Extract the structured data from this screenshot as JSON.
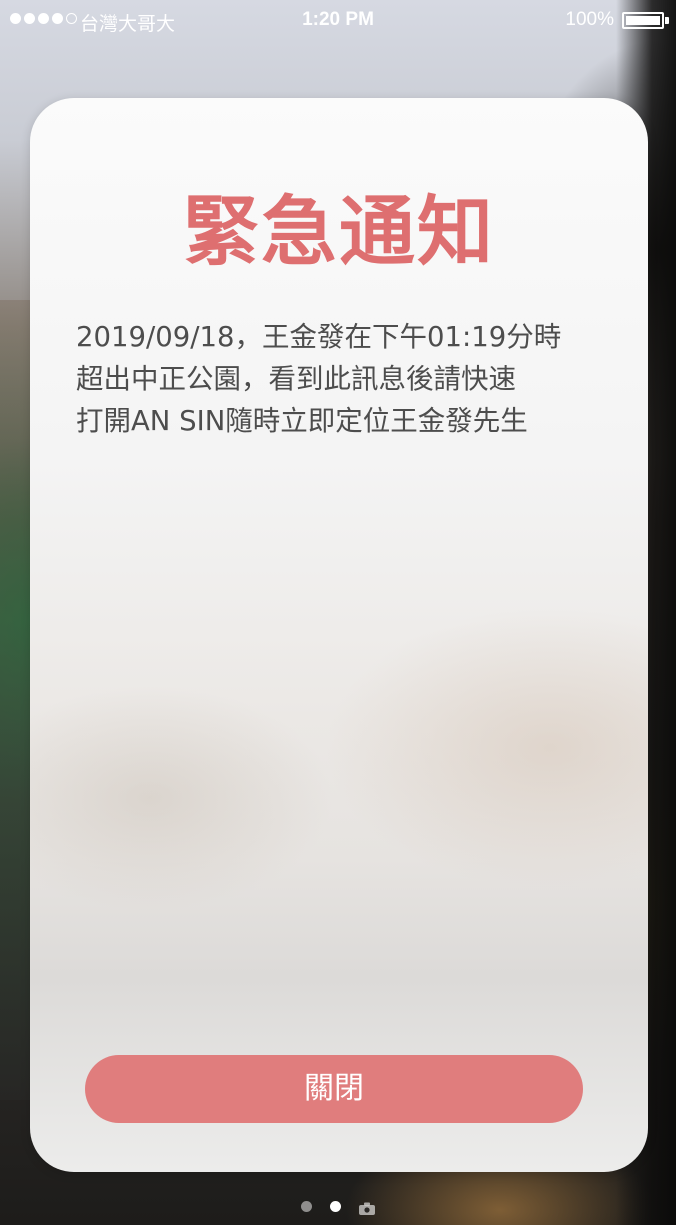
{
  "status_bar": {
    "signal_bars": 4,
    "signal_max": 5,
    "carrier": "台灣大哥大",
    "time": "1:20 PM",
    "battery_percent": "100%",
    "battery_level": 1.0
  },
  "modal": {
    "title": "緊急通知",
    "message_lines": [
      "2019/09/18，王金發在下午01:19分時",
      "超出中正公園，看到此訊息後請快速",
      "打開AN SIN隨時立即定位王金發先生"
    ],
    "close_label": "關閉"
  },
  "page_indicator": {
    "pages": 3,
    "active_index": 1,
    "last_icon": "camera-icon"
  },
  "colors": {
    "title": "#de6f70",
    "button": "#e07d7d",
    "message_text": "#4d4d4d"
  }
}
